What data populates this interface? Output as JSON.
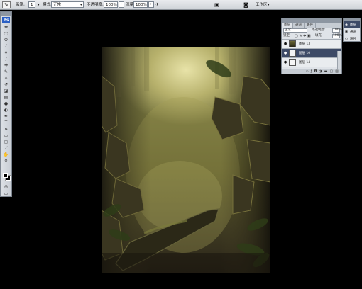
{
  "options_bar": {
    "tool_icon": "brush-icon",
    "brush_label": "画笔:",
    "brush_size": "1",
    "mode_label": "模式:",
    "mode_value": "正常",
    "opacity_label": "不透明度:",
    "opacity_value": "100%",
    "flow_label": "流量:",
    "flow_value": "100%",
    "workspace_label": "工作区"
  },
  "tools": {
    "ps_badge": "Ps",
    "items": [
      "move-tool-icon",
      "marquee-tool-icon",
      "lasso-tool-icon",
      "magic-wand-tool-icon",
      "crop-tool-icon",
      "slice-tool-icon",
      "healing-brush-tool-icon",
      "brush-tool-icon",
      "clone-stamp-tool-icon",
      "history-brush-tool-icon",
      "eraser-tool-icon",
      "gradient-tool-icon",
      "blur-tool-icon",
      "dodge-tool-icon",
      "pen-tool-icon",
      "type-tool-icon",
      "path-selection-tool-icon",
      "shape-tool-icon",
      "notes-tool-icon",
      "eyedropper-tool-icon",
      "hand-tool-icon",
      "zoom-tool-icon"
    ],
    "foreground_color": "#000000",
    "background_color": "#000000"
  },
  "layers_panel": {
    "tabs": [
      "图层",
      "通道",
      "路径"
    ],
    "blend_mode": "正常",
    "opacity_label": "不透明度:",
    "opacity_value": "100%",
    "lock_label": "锁定:",
    "fill_label": "填充:",
    "fill_value": "100%",
    "layers": [
      {
        "name": "图层 13",
        "visible": true,
        "selected": false
      },
      {
        "name": "图层 10",
        "visible": true,
        "selected": true
      },
      {
        "name": "图层 14",
        "visible": true,
        "selected": false
      }
    ],
    "bottom_icons": [
      "link-icon",
      "fx-icon",
      "mask-icon",
      "adjustment-icon",
      "folder-icon",
      "new-layer-icon",
      "trash-icon"
    ]
  },
  "mini_panel": {
    "items": [
      {
        "label": "图层",
        "icon": "layers-icon",
        "active": true
      },
      {
        "label": "通道",
        "icon": "channels-icon",
        "active": false
      },
      {
        "label": "路径",
        "icon": "paths-icon",
        "active": false
      }
    ]
  },
  "colors": {
    "canvas_highlight": "#e8e3a8",
    "canvas_mid": "#6f6e3a",
    "canvas_dark": "#2b2519",
    "panel_bg": "#dfe3e8",
    "selection": "#3d4a66"
  }
}
